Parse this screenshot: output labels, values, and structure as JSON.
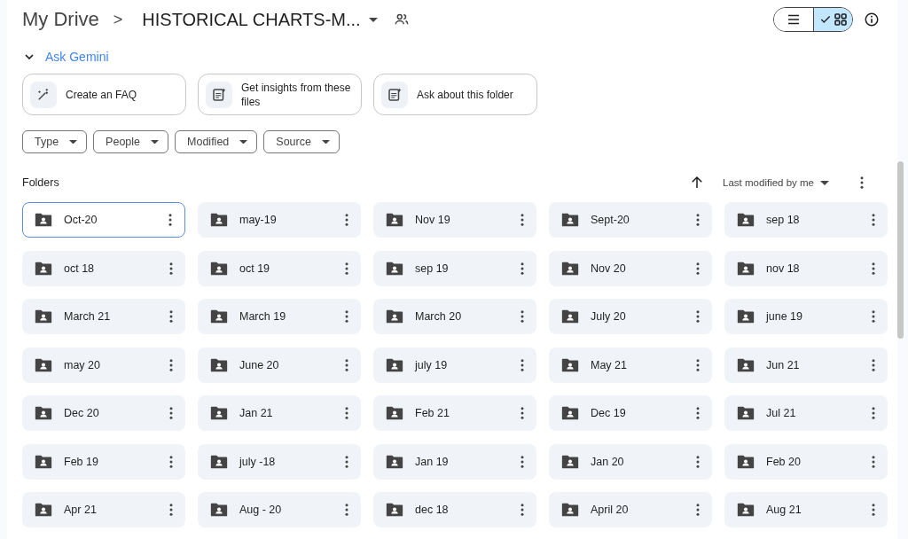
{
  "breadcrumb": {
    "root": "My Drive",
    "separator": ">",
    "current": "HISTORICAL CHARTS-M..."
  },
  "view_toggle": [
    {
      "kind": "list",
      "selected": false
    },
    {
      "kind": "grid",
      "selected": true
    }
  ],
  "gemini": {
    "label": "Ask Gemini",
    "expanded": true,
    "suggestions": [
      {
        "kind": "pen",
        "label": "Create an FAQ"
      },
      {
        "kind": "doc",
        "label": "Get insights from these files"
      },
      {
        "kind": "doc",
        "label": "Ask about this folder"
      }
    ]
  },
  "filters": [
    "Type",
    "People",
    "Modified",
    "Source"
  ],
  "folders_section": {
    "title": "Folders",
    "sort": "Last modified by me"
  },
  "folders": [
    {
      "name": "Oct-20",
      "selected": true
    },
    {
      "name": "may-19",
      "selected": false
    },
    {
      "name": "Nov 19",
      "selected": false
    },
    {
      "name": "Sept-20",
      "selected": false
    },
    {
      "name": "sep 18",
      "selected": false
    },
    {
      "name": "oct 18",
      "selected": false
    },
    {
      "name": "oct 19",
      "selected": false
    },
    {
      "name": "sep 19",
      "selected": false
    },
    {
      "name": "Nov 20",
      "selected": false
    },
    {
      "name": "nov 18",
      "selected": false
    },
    {
      "name": "March 21",
      "selected": false
    },
    {
      "name": "March 19",
      "selected": false
    },
    {
      "name": "March 20",
      "selected": false
    },
    {
      "name": "July 20",
      "selected": false
    },
    {
      "name": "june 19",
      "selected": false
    },
    {
      "name": "may 20",
      "selected": false
    },
    {
      "name": "June 20",
      "selected": false
    },
    {
      "name": "july 19",
      "selected": false
    },
    {
      "name": "May 21",
      "selected": false
    },
    {
      "name": "Jun 21",
      "selected": false
    },
    {
      "name": "Dec 20",
      "selected": false
    },
    {
      "name": "Jan 21",
      "selected": false
    },
    {
      "name": "Feb 21",
      "selected": false
    },
    {
      "name": "Dec 19",
      "selected": false
    },
    {
      "name": "Jul 21",
      "selected": false
    },
    {
      "name": "Feb 19",
      "selected": false
    },
    {
      "name": "july -18",
      "selected": false
    },
    {
      "name": "Jan 19",
      "selected": false
    },
    {
      "name": "Jan 20",
      "selected": false
    },
    {
      "name": "Feb 20",
      "selected": false
    },
    {
      "name": "Apr 21",
      "selected": false
    },
    {
      "name": "Aug - 20",
      "selected": false
    },
    {
      "name": "dec 18",
      "selected": false
    },
    {
      "name": "April 20",
      "selected": false
    },
    {
      "name": "Aug 21",
      "selected": false
    }
  ]
}
